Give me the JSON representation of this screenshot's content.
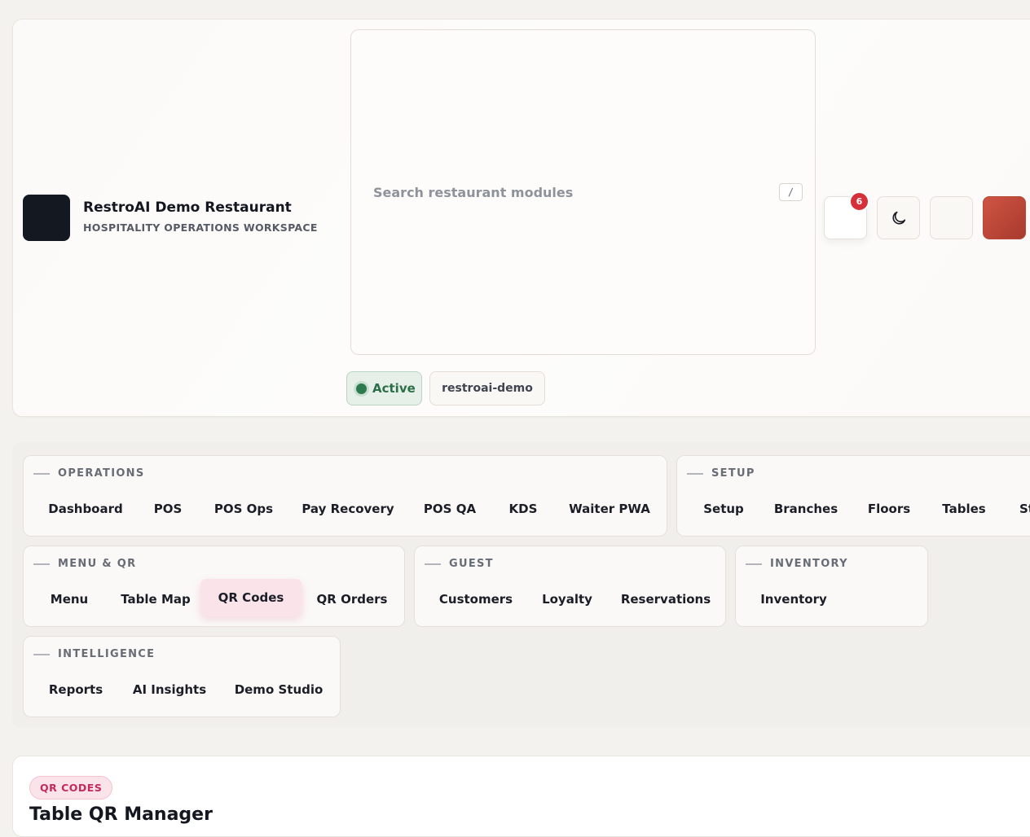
{
  "brand": {
    "name": "RestroAI Demo Restaurant",
    "subtitle": "HOSPITALITY OPERATIONS WORKSPACE"
  },
  "search": {
    "placeholder": "Search restaurant modules",
    "shortcut": "/"
  },
  "header_actions": {
    "notification_count": "6",
    "theme_icon": "moon-icon"
  },
  "status": {
    "label": "Active",
    "slug": "restroai-demo"
  },
  "nav": {
    "operations": {
      "title": "OPERATIONS",
      "items": [
        "Dashboard",
        "POS",
        "POS Ops",
        "Pay Recovery",
        "POS QA",
        "KDS",
        "Waiter PWA"
      ]
    },
    "setup": {
      "title": "SETUP",
      "items": [
        "Setup",
        "Branches",
        "Floors",
        "Tables",
        "Staff"
      ]
    },
    "menu_qr": {
      "title": "MENU & QR",
      "items": [
        "Menu",
        "Table Map",
        "QR Codes",
        "QR Orders"
      ],
      "active": "QR Codes"
    },
    "guest": {
      "title": "GUEST",
      "items": [
        "Customers",
        "Loyalty",
        "Reservations"
      ]
    },
    "inventory": {
      "title": "INVENTORY",
      "items": [
        "Inventory"
      ]
    },
    "intelligence": {
      "title": "INTELLIGENCE",
      "items": [
        "Reports",
        "AI Insights",
        "Demo Studio"
      ]
    }
  },
  "content": {
    "section_label": "QR CODES",
    "title": "Table QR Manager"
  },
  "colors": {
    "accent": "#c42a5a",
    "active_green": "#2d7a4e",
    "badge_red": "#d6303a",
    "avatar": "#c44a3a"
  }
}
